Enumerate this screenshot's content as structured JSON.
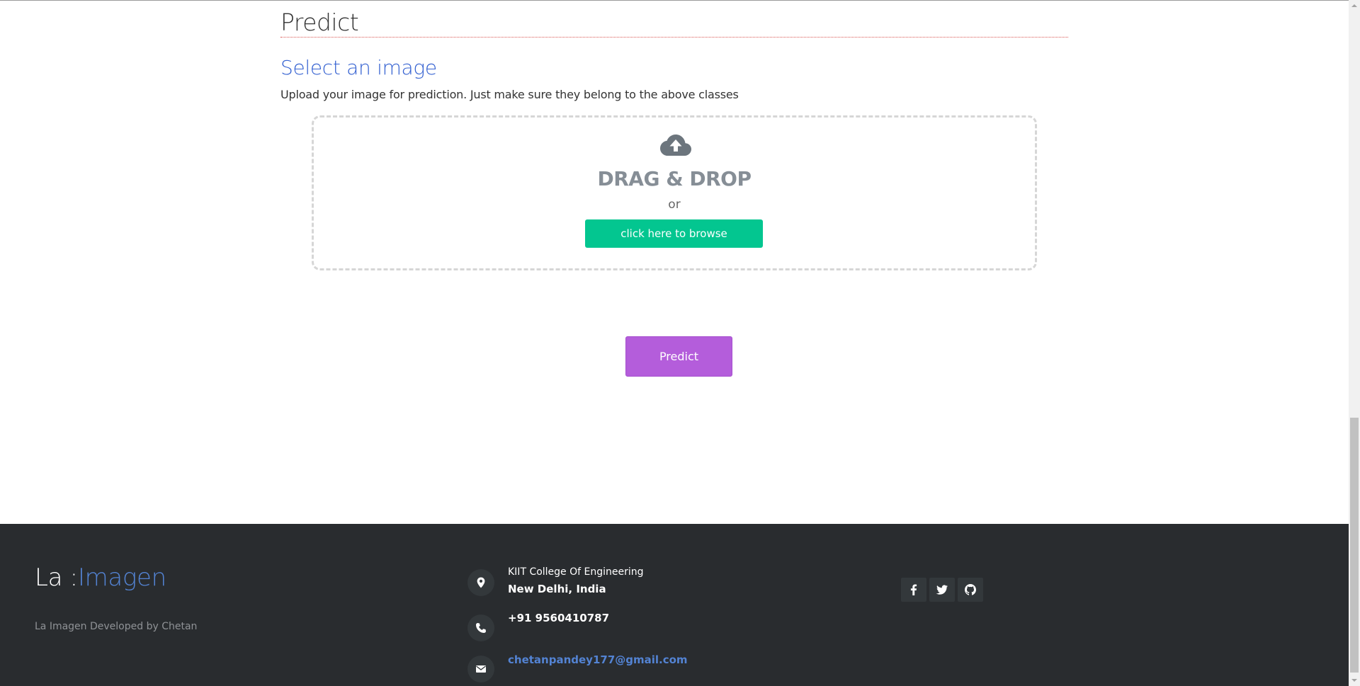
{
  "main": {
    "section_title": "Predict",
    "subheading": "Select an image",
    "description": "Upload your image for prediction. Just make sure they belong to the above classes",
    "dropzone": {
      "icon": "cloud-upload-icon",
      "title": "DRAG & DROP",
      "or_text": "or",
      "browse_label": "click here to browse"
    },
    "predict_label": "Predict"
  },
  "footer": {
    "logo_prefix": "La :",
    "logo_accent": "Imagen",
    "credit": "La Imagen Developed by Chetan",
    "address_line1": "KIIT College Of Engineering",
    "address_line2": "New Delhi, India",
    "phone": "+91 9560410787",
    "email": "chetanpandey177@gmail.com",
    "icons": {
      "address": "map-marker-icon",
      "phone": "phone-icon",
      "email": "envelope-icon"
    },
    "social": [
      "facebook-icon",
      "twitter-icon",
      "github-icon"
    ]
  },
  "colors": {
    "accent_blue": "#3461d1",
    "browse_green": "#03c690",
    "predict_purple": "#b45ddb",
    "footer_bg": "#292c2f",
    "footer_link": "#5383d3"
  }
}
